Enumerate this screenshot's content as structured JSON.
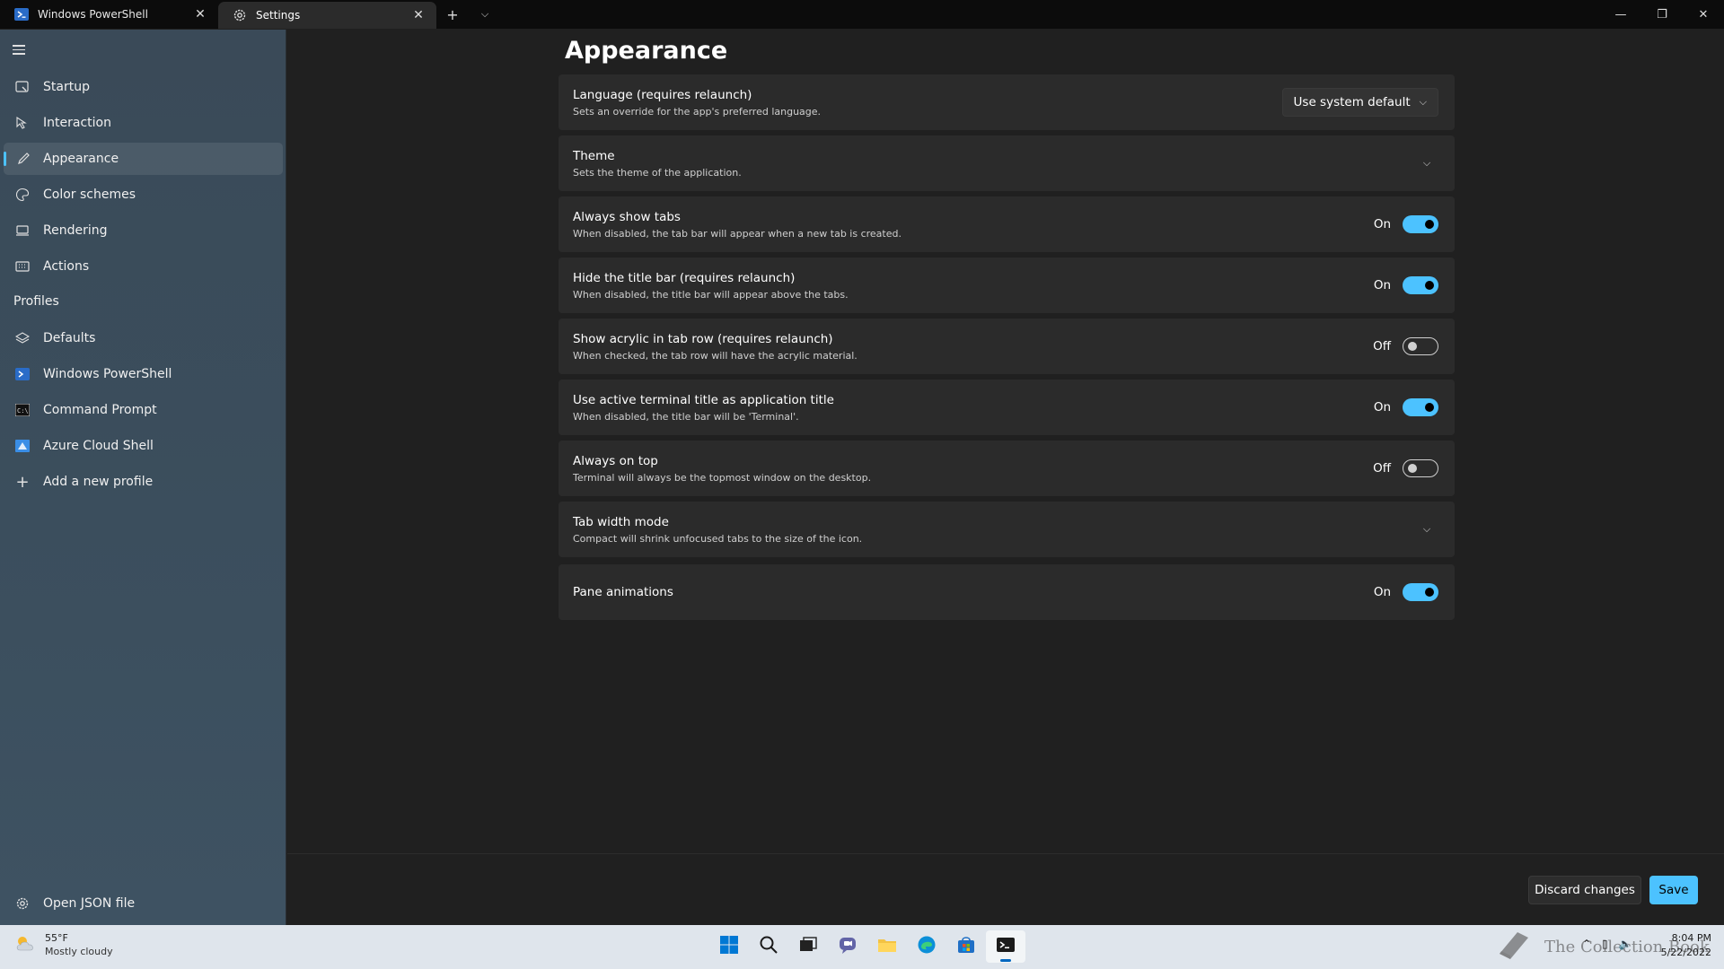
{
  "tabs": [
    {
      "label": "Windows PowerShell",
      "icon": "powershell-icon"
    },
    {
      "label": "Settings",
      "icon": "gear-icon"
    }
  ],
  "sidebar": {
    "items": [
      {
        "label": "Startup"
      },
      {
        "label": "Interaction"
      },
      {
        "label": "Appearance"
      },
      {
        "label": "Color schemes"
      },
      {
        "label": "Rendering"
      },
      {
        "label": "Actions"
      }
    ],
    "profiles_header": "Profiles",
    "profiles": [
      {
        "label": "Defaults"
      },
      {
        "label": "Windows PowerShell"
      },
      {
        "label": "Command Prompt"
      },
      {
        "label": "Azure Cloud Shell"
      },
      {
        "label": "Add a new profile"
      }
    ],
    "open_json": "Open JSON file",
    "active_item": "Appearance"
  },
  "main": {
    "title": "Appearance",
    "settings": [
      {
        "title": "Language (requires relaunch)",
        "desc": "Sets an override for the app's preferred language.",
        "control": "dropdown",
        "value": "Use system default"
      },
      {
        "title": "Theme",
        "desc": "Sets the theme of the application.",
        "control": "expander"
      },
      {
        "title": "Always show tabs",
        "desc": "When disabled, the tab bar will appear when a new tab is created.",
        "control": "toggle",
        "state": "On"
      },
      {
        "title": "Hide the title bar (requires relaunch)",
        "desc": "When disabled, the title bar will appear above the tabs.",
        "control": "toggle",
        "state": "On"
      },
      {
        "title": "Show acrylic in tab row (requires relaunch)",
        "desc": "When checked, the tab row will have the acrylic material.",
        "control": "toggle",
        "state": "Off"
      },
      {
        "title": "Use active terminal title as application title",
        "desc": "When disabled, the title bar will be 'Terminal'.",
        "control": "toggle",
        "state": "On"
      },
      {
        "title": "Always on top",
        "desc": "Terminal will always be the topmost window on the desktop.",
        "control": "toggle",
        "state": "Off"
      },
      {
        "title": "Tab width mode",
        "desc": "Compact will shrink unfocused tabs to the size of the icon.",
        "control": "expander"
      },
      {
        "title": "Pane animations",
        "desc": "",
        "control": "toggle",
        "state": "On"
      }
    ]
  },
  "footer": {
    "discard_label": "Discard changes",
    "save_label": "Save"
  },
  "taskbar": {
    "weather_temp": "55°F",
    "weather_desc": "Mostly cloudy",
    "time": "8:04 PM",
    "date": "5/22/2022",
    "watermark": "The Collection Book"
  },
  "colors": {
    "accent": "#4cc2ff",
    "sidebar_bg": "#3b4e5d",
    "card_bg": "#2b2b2b",
    "page_bg": "#202020"
  }
}
